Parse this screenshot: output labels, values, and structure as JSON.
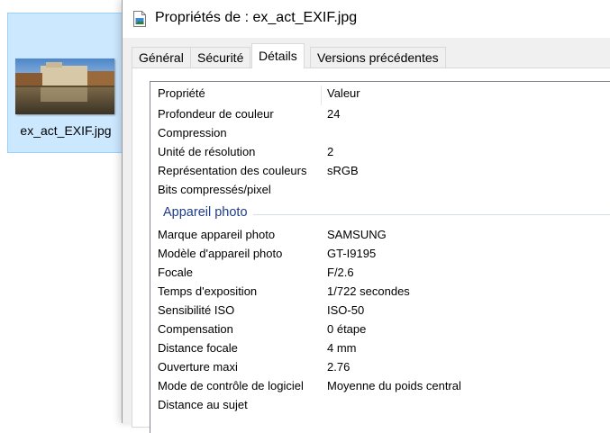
{
  "file": {
    "name": "ex_act_EXIF.jpg"
  },
  "dialog": {
    "title": "Propriétés de : ex_act_EXIF.jpg",
    "tabs": [
      {
        "label": "Général",
        "active": false
      },
      {
        "label": "Sécurité",
        "active": false
      },
      {
        "label": "Détails",
        "active": true
      },
      {
        "label": "Versions précédentes",
        "active": false
      }
    ]
  },
  "details": {
    "headers": {
      "property": "Propriété",
      "value": "Valeur"
    },
    "image_rows": [
      {
        "property": "Profondeur de couleur",
        "value": "24"
      },
      {
        "property": "Compression",
        "value": ""
      },
      {
        "property": "Unité de résolution",
        "value": "2"
      },
      {
        "property": "Représentation des couleurs",
        "value": "sRGB"
      },
      {
        "property": "Bits compressés/pixel",
        "value": ""
      }
    ],
    "camera_group": "Appareil photo",
    "camera_rows": [
      {
        "property": "Marque appareil photo",
        "value": "SAMSUNG"
      },
      {
        "property": "Modèle d'appareil photo",
        "value": "GT-I9195"
      },
      {
        "property": "Focale",
        "value": "F/2.6"
      },
      {
        "property": "Temps d'exposition",
        "value": "1/722 secondes"
      },
      {
        "property": "Sensibilité ISO",
        "value": "ISO-50"
      },
      {
        "property": "Compensation",
        "value": "0 étape"
      },
      {
        "property": "Distance focale",
        "value": "4 mm"
      },
      {
        "property": "Ouverture maxi",
        "value": "2.76"
      },
      {
        "property": "Mode de contrôle de logiciel",
        "value": "Moyenne du poids central"
      },
      {
        "property": "Distance au sujet",
        "value": ""
      }
    ]
  }
}
